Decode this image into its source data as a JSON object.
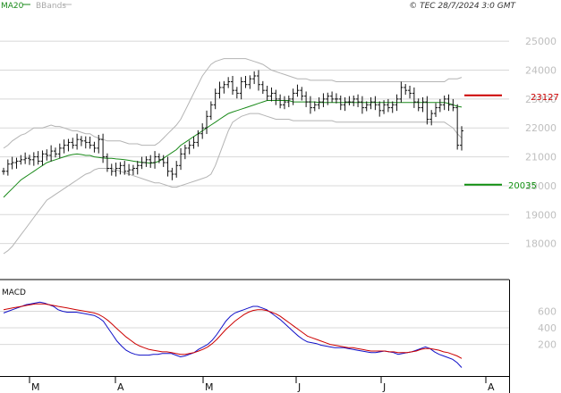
{
  "header": {
    "legend": [
      {
        "label": "MA20",
        "color": "#1a8a1a"
      },
      {
        "label": "BBands",
        "color": "#b4b4b4"
      }
    ],
    "copyright": "© TEC 28/7/2024 3:0 GMT"
  },
  "chart_data": [
    {
      "type": "line",
      "subtype": "ohlc-bars",
      "title": "",
      "ylim": [
        17000,
        25500
      ],
      "y_ticks": [
        {
          "value": 18000,
          "label": "18000"
        },
        {
          "value": 19000,
          "label": "19000"
        },
        {
          "value": 20000,
          "label": "20000"
        },
        {
          "value": 21000,
          "label": "21000"
        },
        {
          "value": 22000,
          "label": "22000"
        },
        {
          "value": 23000,
          "label": "23000"
        },
        {
          "value": 24000,
          "label": "24000"
        },
        {
          "value": 25000,
          "label": "25000"
        }
      ],
      "x_ticks": [
        "M",
        "A",
        "M",
        "J",
        "J",
        "A"
      ],
      "grid": true,
      "legend_position": "top-left",
      "annotations": [
        {
          "label": "23127",
          "value": 23127,
          "color": "#cc0000"
        },
        {
          "label": "20035",
          "value": 20035,
          "color": "#109010"
        }
      ],
      "colors": {
        "price": "#111111",
        "ma20": "#1a8a1a",
        "bbands": "#b4b4b4"
      },
      "series": [
        {
          "name": "Price",
          "closes": [
            20500,
            20750,
            20800,
            20850,
            20900,
            20950,
            20900,
            21000,
            20850,
            21100,
            21050,
            21200,
            21100,
            21300,
            21400,
            21500,
            21400,
            21600,
            21550,
            21500,
            21400,
            21300,
            21600,
            21000,
            20600,
            20500,
            20600,
            20700,
            20500,
            20550,
            20600,
            20700,
            20800,
            20900,
            20800,
            21000,
            20900,
            20800,
            20500,
            20400,
            20700,
            21100,
            21300,
            21400,
            21500,
            21800,
            22000,
            22400,
            22800,
            23200,
            23400,
            23500,
            23600,
            23300,
            23200,
            23600,
            23500,
            23700,
            23800,
            23500,
            23300,
            23100,
            23200,
            23000,
            22800,
            22900,
            23000,
            23200,
            23300,
            23100,
            22900,
            22700,
            22800,
            22900,
            23000,
            23100,
            23000,
            23000,
            22800,
            22900,
            22900,
            23000,
            22900,
            22700,
            22800,
            22900,
            22800,
            22600,
            22800,
            22700,
            22800,
            23000,
            23400,
            23300,
            23200,
            22900,
            22700,
            22900,
            22300,
            22500,
            22700,
            22800,
            23000,
            22800,
            22700,
            21400,
            21900
          ]
        },
        {
          "name": "MA20",
          "values": [
            19600,
            19750,
            19900,
            20050,
            20200,
            20300,
            20400,
            20500,
            20600,
            20700,
            20800,
            20850,
            20900,
            20950,
            21000,
            21050,
            21080,
            21100,
            21080,
            21050,
            21050,
            21000,
            20980,
            20960,
            20950,
            20950,
            20930,
            20920,
            20900,
            20880,
            20850,
            20830,
            20810,
            20800,
            20780,
            20800,
            20850,
            20950,
            21050,
            21150,
            21250,
            21400,
            21500,
            21600,
            21700,
            21800,
            21900,
            22000,
            22100,
            22200,
            22300,
            22400,
            22500,
            22550,
            22600,
            22650,
            22700,
            22750,
            22800,
            22850,
            22900,
            22950,
            22950,
            22950,
            22950,
            22950,
            22950,
            22900,
            22900,
            22900,
            22900,
            22900,
            22900,
            22880,
            22880,
            22880,
            22880,
            22880,
            22880,
            22880,
            22880,
            22880,
            22880,
            22880,
            22880,
            22880,
            22880,
            22880,
            22880,
            22880,
            22880,
            22880,
            22880,
            22880,
            22880,
            22880,
            22880,
            22880,
            22880,
            22880,
            22880,
            22880,
            22880,
            22850,
            22800,
            22750,
            22720
          ]
        },
        {
          "name": "BBand upper",
          "values": [
            21300,
            21400,
            21550,
            21650,
            21750,
            21800,
            21900,
            22000,
            22000,
            22000,
            22050,
            22100,
            22050,
            22050,
            22000,
            21950,
            21900,
            21900,
            21850,
            21800,
            21800,
            21700,
            21650,
            21600,
            21550,
            21550,
            21550,
            21550,
            21500,
            21450,
            21450,
            21450,
            21400,
            21400,
            21400,
            21400,
            21500,
            21650,
            21800,
            21950,
            22100,
            22300,
            22600,
            22900,
            23200,
            23500,
            23800,
            24000,
            24200,
            24300,
            24350,
            24400,
            24400,
            24400,
            24400,
            24400,
            24400,
            24350,
            24300,
            24250,
            24200,
            24100,
            24000,
            23950,
            23900,
            23850,
            23800,
            23750,
            23700,
            23700,
            23700,
            23650,
            23650,
            23650,
            23650,
            23650,
            23650,
            23600,
            23600,
            23600,
            23600,
            23600,
            23600,
            23600,
            23600,
            23600,
            23600,
            23600,
            23600,
            23600,
            23600,
            23600,
            23600,
            23600,
            23600,
            23600,
            23600,
            23600,
            23600,
            23600,
            23600,
            23600,
            23600,
            23700,
            23700,
            23700,
            23750
          ]
        },
        {
          "name": "BBand lower",
          "values": [
            17650,
            17750,
            17900,
            18100,
            18300,
            18500,
            18700,
            18900,
            19100,
            19300,
            19500,
            19600,
            19700,
            19800,
            19900,
            20000,
            20100,
            20200,
            20300,
            20400,
            20450,
            20550,
            20600,
            20600,
            20600,
            20600,
            20550,
            20500,
            20450,
            20400,
            20350,
            20300,
            20250,
            20200,
            20150,
            20100,
            20100,
            20050,
            20000,
            19950,
            19950,
            20000,
            20050,
            20100,
            20150,
            20200,
            20250,
            20300,
            20400,
            20700,
            21100,
            21500,
            21900,
            22200,
            22300,
            22400,
            22450,
            22500,
            22500,
            22500,
            22450,
            22400,
            22350,
            22300,
            22300,
            22300,
            22300,
            22250,
            22250,
            22250,
            22250,
            22250,
            22250,
            22250,
            22250,
            22250,
            22250,
            22200,
            22200,
            22200,
            22200,
            22200,
            22200,
            22200,
            22200,
            22200,
            22200,
            22200,
            22200,
            22200,
            22200,
            22200,
            22200,
            22200,
            22200,
            22200,
            22200,
            22200,
            22200,
            22200,
            22200,
            22200,
            22200,
            22100,
            22000,
            21800,
            21650
          ]
        }
      ]
    },
    {
      "type": "line",
      "title": "MACD",
      "ylim": [
        -150,
        800
      ],
      "y_ticks": [
        {
          "value": 200,
          "label": "200"
        },
        {
          "value": 400,
          "label": "400"
        },
        {
          "value": 600,
          "label": "600"
        }
      ],
      "grid": true,
      "colors": {
        "macd": "#1010c8",
        "signal": "#cc0000"
      },
      "series": [
        {
          "name": "MACD",
          "values": [
            580,
            600,
            620,
            640,
            660,
            680,
            690,
            700,
            710,
            700,
            680,
            660,
            620,
            600,
            590,
            590,
            590,
            580,
            570,
            560,
            550,
            520,
            480,
            400,
            320,
            240,
            180,
            130,
            100,
            80,
            70,
            70,
            70,
            80,
            80,
            90,
            90,
            90,
            70,
            50,
            60,
            80,
            100,
            140,
            170,
            200,
            250,
            320,
            400,
            480,
            540,
            580,
            600,
            620,
            640,
            660,
            660,
            640,
            620,
            580,
            540,
            500,
            450,
            400,
            350,
            300,
            260,
            230,
            220,
            210,
            190,
            180,
            170,
            160,
            160,
            160,
            150,
            140,
            130,
            120,
            110,
            100,
            100,
            110,
            120,
            110,
            100,
            80,
            90,
            100,
            110,
            130,
            150,
            170,
            150,
            110,
            80,
            60,
            40,
            20,
            -20,
            -80
          ]
        },
        {
          "name": "Signal",
          "values": [
            620,
            630,
            640,
            650,
            660,
            670,
            680,
            690,
            690,
            690,
            680,
            670,
            660,
            650,
            640,
            630,
            620,
            610,
            600,
            590,
            580,
            560,
            530,
            490,
            440,
            390,
            340,
            290,
            250,
            210,
            180,
            160,
            140,
            130,
            120,
            110,
            110,
            100,
            90,
            80,
            80,
            90,
            100,
            120,
            140,
            170,
            210,
            260,
            320,
            380,
            430,
            480,
            520,
            560,
            590,
            610,
            620,
            620,
            610,
            590,
            570,
            540,
            500,
            460,
            420,
            380,
            340,
            300,
            280,
            260,
            240,
            220,
            200,
            190,
            180,
            170,
            160,
            160,
            150,
            140,
            130,
            120,
            120,
            120,
            120,
            110,
            110,
            100,
            100,
            100,
            110,
            120,
            140,
            150,
            150,
            140,
            130,
            110,
            100,
            80,
            60,
            30
          ]
        }
      ]
    }
  ]
}
